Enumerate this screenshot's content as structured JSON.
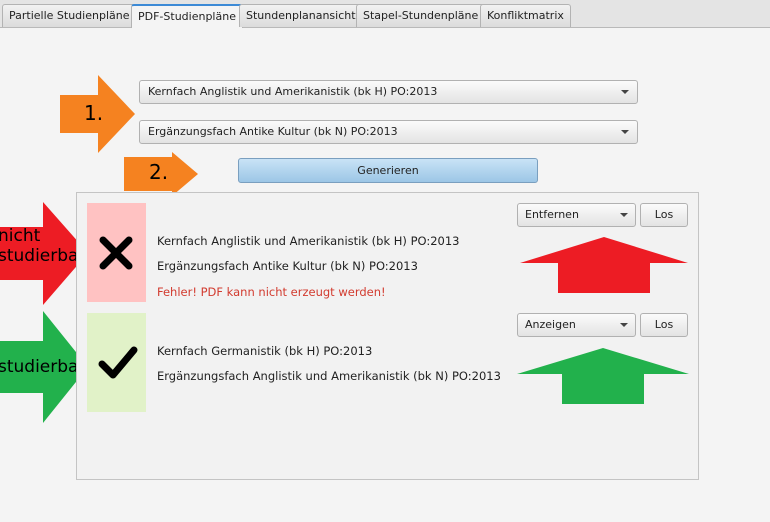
{
  "tabs": [
    {
      "label": "Partielle Studienpläne"
    },
    {
      "label": "PDF-Studienpläne"
    },
    {
      "label": "Stundenplanansicht"
    },
    {
      "label": "Stapel-Stundenpläne"
    },
    {
      "label": "Konfliktmatrix"
    }
  ],
  "selection": {
    "major": "Kernfach Anglistik und Amerikanistik (bk H) PO:2013",
    "minor": "Ergänzungsfach Antike Kultur (bk N) PO:2013"
  },
  "generate_label": "Generieren",
  "results": [
    {
      "status": "error",
      "line1": "Kernfach Anglistik und Amerikanistik (bk H) PO:2013",
      "line2": "Ergänzungsfach Antike Kultur (bk N) PO:2013",
      "error": "Fehler! PDF kann nicht erzeugt werden!",
      "action": "Entfernen",
      "go": "Los"
    },
    {
      "status": "ok",
      "line1": "Kernfach Germanistik (bk H) PO:2013",
      "line2": "Ergänzungsfach Anglistik und Amerikanistik (bk N) PO:2013",
      "action": "Anzeigen",
      "go": "Los"
    }
  ],
  "annotations": {
    "step1": "1.",
    "step2": "2.",
    "not_studyable_1": "nicht",
    "not_studyable_2": "studierbar",
    "studyable": "studierbar"
  },
  "colors": {
    "orange": "#f58220",
    "red": "#ed1c24",
    "green": "#22b14c",
    "error_bg": "#ffc2c2",
    "ok_bg": "#e1f2c8",
    "accent_tab": "#3c8ad6"
  }
}
